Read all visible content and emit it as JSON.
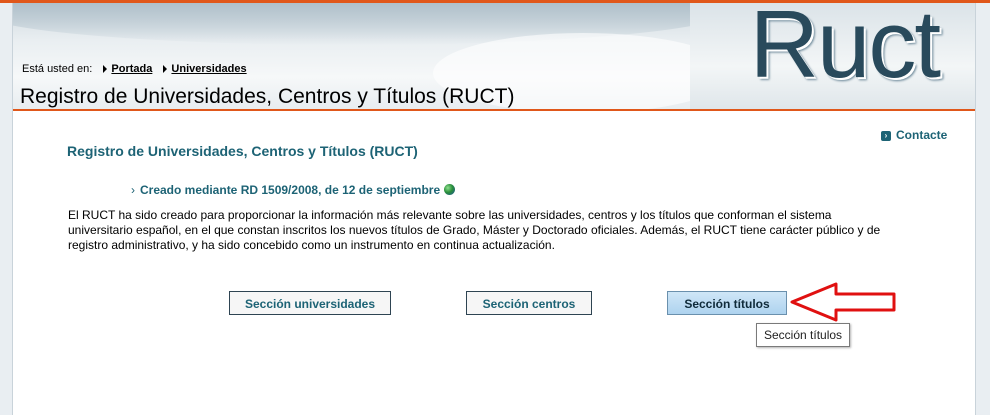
{
  "header": {
    "logo_text": "Ruct",
    "breadcrumb_label": "Está usted en:",
    "breadcrumb_items": [
      "Portada",
      "Universidades"
    ],
    "site_title": "Registro de Universidades, Centros y Títulos (RUCT)"
  },
  "contact": {
    "label": "Contacte",
    "icon": "arrow-square-icon"
  },
  "main": {
    "title": "Registro de Universidades, Centros y Títulos (RUCT)",
    "decree_link": "Creado mediante RD 1509/2008, de 12 de septiembre",
    "description": "El RUCT ha sido creado para proporcionar la información más relevante sobre las universidades, centros y los títulos que conforman el sistema universitario español, en el que constan inscritos los nuevos títulos de Grado, Máster y Doctorado oficiales. Además, el RUCT tiene carácter público y de registro administrativo, y ha sido concebido como un instrumento en continua actualización.",
    "buttons": {
      "universidades": "Sección universidades",
      "centros": "Sección centros",
      "titulos": "Sección títulos"
    },
    "tooltip": "Sección títulos"
  },
  "colors": {
    "accent_orange": "#e0571a",
    "link_teal": "#1d6375",
    "annotation_red": "#e01010"
  }
}
